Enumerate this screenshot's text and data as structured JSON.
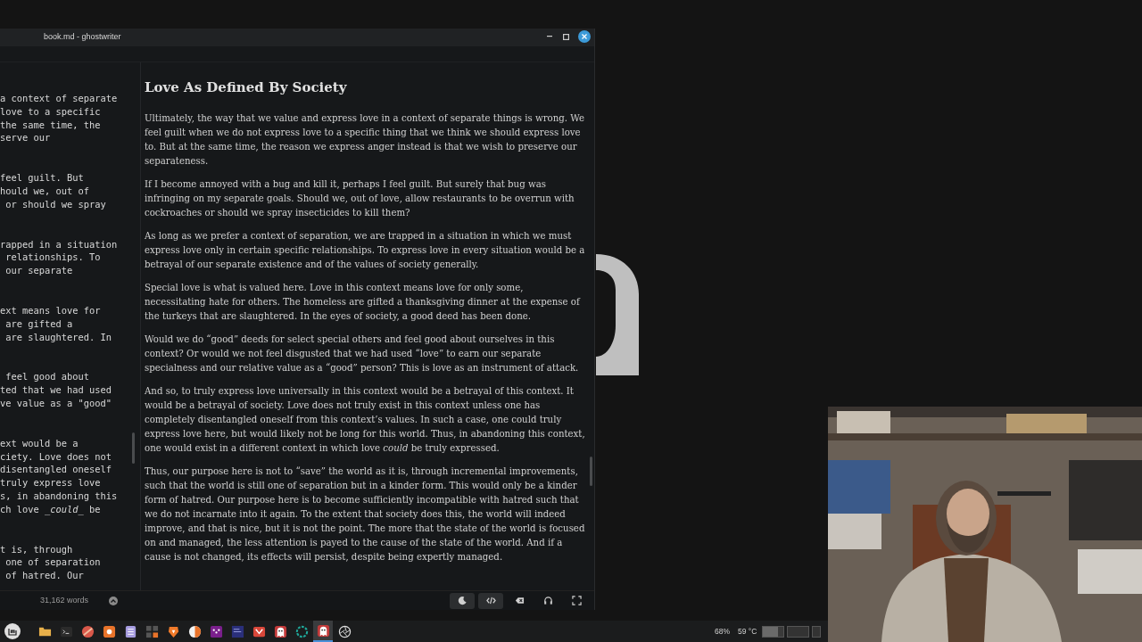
{
  "window": {
    "title": "book.md - ghostwriter"
  },
  "source_pane": {
    "paragraphs": [
      [
        "a context of separate",
        "love to a specific",
        "the same time, the",
        "serve our"
      ],
      [
        "feel guilt. But",
        "hould we, out of",
        " or should we spray"
      ],
      [
        "rapped in a situation",
        " relationships. To",
        " our separate"
      ],
      [
        "ext means love for",
        " are gifted a",
        " are slaughtered. In"
      ],
      [
        " feel good about",
        "ted that we had used",
        "ve value as a \"good\""
      ],
      [
        "ext would be a",
        "ciety. Love does not",
        "disentangled oneself",
        "truly express love",
        "s, in abandoning this",
        "ch love *_could_* be"
      ],
      [
        "t is, through",
        " one of separation",
        " of hatred. Our"
      ]
    ]
  },
  "preview": {
    "heading": "Love As Defined By Society",
    "paragraphs": [
      "Ultimately, the way that we value and express love in a context of separate things is wrong. We feel guilt when we do not express love to a specific thing that we think we should express love to. But at the same time, the reason we express anger instead is that we wish to preserve our separateness.",
      "If I become annoyed with a bug and kill it, perhaps I feel guilt. But surely that bug was infringing on my separate goals. Should we, out of love, allow restaurants to be overrun with cockroaches or should we spray insecticides to kill them?",
      "As long as we prefer a context of separation, we are trapped in a situation in which we must express love only in certain specific relationships. To express love in every situation would be a betrayal of our separate existence and of the values of society generally.",
      "Special love is what is valued here. Love in this context means love for only some, necessitating hate for others. The homeless are gifted a thanksgiving dinner at the expense of the turkeys that are slaughtered. In the eyes of society, a good deed has been done.",
      "Would we do “good” deeds for select special others and feel good about ourselves in this context? Or would we not feel disgusted that we had used “love” to earn our separate specialness and our relative value as a “good” person? This is love as an instrument of attack.",
      "And so, to truly express love universally in this context would be a betrayal of this context. It would be a betrayal of society. Love does not truly exist in this context unless one has completely disentangled oneself from this context’s values. In such a case, one could truly express love here, but would likely not be long for this world. Thus, in abandoning this context, one would exist in a different context in which love *could* be truly expressed.",
      "Thus, our purpose here is not to “save” the world as it is, through incremental improvements, such that the world is still one of separation but in a kinder form. This would only be a kinder form of hatred. Our purpose here is to become sufficiently incompatible with hatred such that we do not incarnate into it again. To the extent that society does this, the world will indeed improve, and that is nice, but it is not the point. The more that the state of the world is focused on and managed, the less attention is payed to the cause of the state of the world. And if a cause is not changed, its effects will persist, despite being expertly managed."
    ]
  },
  "status_bar": {
    "word_count": "31,162 words",
    "buttons": [
      {
        "kind": "moon",
        "on": true
      },
      {
        "kind": "code",
        "on": true
      },
      {
        "kind": "backspace",
        "on": false
      },
      {
        "kind": "headphones",
        "on": false
      },
      {
        "kind": "fullscreen",
        "on": false
      }
    ]
  },
  "taskbar": {
    "apps": [
      {
        "kind": "folder",
        "selected": false
      },
      {
        "kind": "terminal",
        "selected": false
      },
      {
        "kind": "red",
        "selected": false
      },
      {
        "kind": "orange",
        "selected": false
      },
      {
        "kind": "notes",
        "selected": false
      },
      {
        "kind": "calc",
        "selected": false
      },
      {
        "kind": "shield",
        "selected": false
      },
      {
        "kind": "circle",
        "selected": false
      },
      {
        "kind": "tools",
        "selected": false
      },
      {
        "kind": "blue",
        "selected": false
      },
      {
        "kind": "fox",
        "selected": false
      },
      {
        "kind": "ghost",
        "selected": false
      },
      {
        "kind": "teal",
        "selected": false
      },
      {
        "kind": "ghost",
        "selected": true
      },
      {
        "kind": "lens",
        "selected": false
      }
    ],
    "battery": "68%",
    "temperature": "59 °C"
  }
}
